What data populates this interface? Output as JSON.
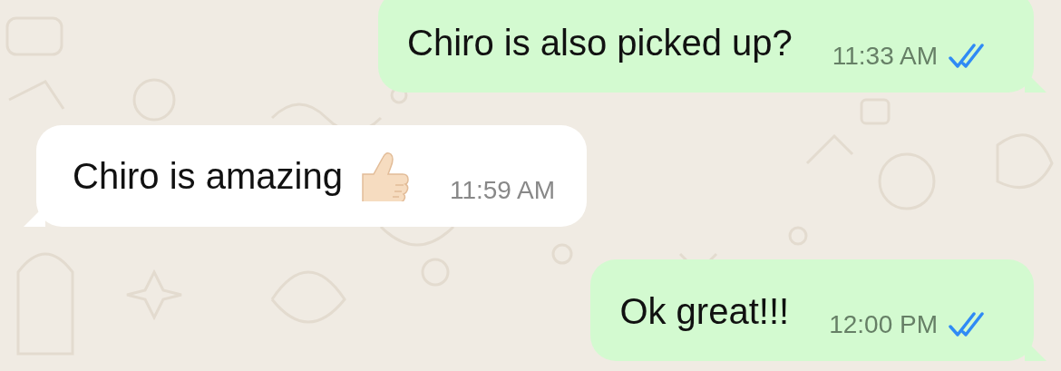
{
  "messages": [
    {
      "kind": "outgoing",
      "text": "Chiro is also picked up?",
      "time": "11:33 AM",
      "read": true,
      "has_emoji": false
    },
    {
      "kind": "incoming",
      "text": "Chiro is amazing",
      "time": "11:59 AM",
      "has_emoji": true
    },
    {
      "kind": "outgoing",
      "text": "Ok great!!!",
      "time": "12:00 PM",
      "read": true,
      "has_emoji": false
    }
  ]
}
